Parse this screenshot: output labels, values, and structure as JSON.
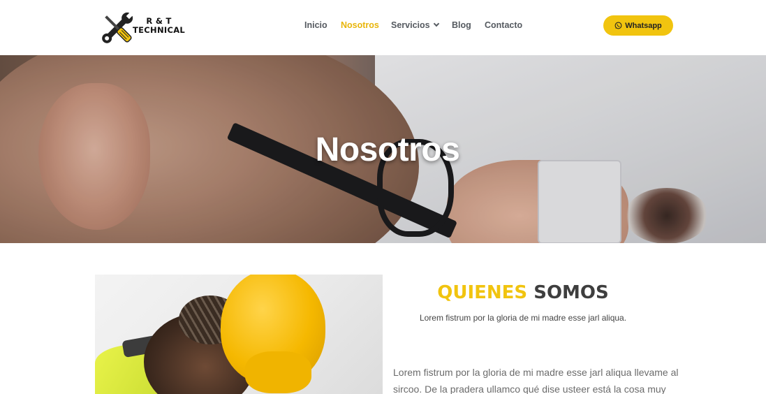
{
  "header": {
    "logo": {
      "line1": "R & T",
      "line2": "TECHNICAL",
      "icon": "tools-wrench-screwdriver-icon"
    },
    "nav": [
      {
        "label": "Inicio",
        "active": false
      },
      {
        "label": "Nosotros",
        "active": true
      },
      {
        "label": "Servicios",
        "active": false,
        "has_dropdown": true
      },
      {
        "label": "Blog",
        "active": false
      },
      {
        "label": "Contacto",
        "active": false
      }
    ],
    "whatsapp_button": {
      "label": "Whatsapp",
      "icon": "whatsapp-icon"
    }
  },
  "hero": {
    "title": "Nosotros"
  },
  "about": {
    "heading_highlight": "QUIENES",
    "heading_rest": "SOMOS",
    "subtitle": "Lorem fistrum por la gloria de mi madre esse jarl aliqua.",
    "body_line1": "Lorem fistrum por la gloria de mi madre esse jarl aliqua llevame al",
    "body_line2": "sircoo. De la pradera ullamco qué dise usteer está la cosa muy"
  },
  "colors": {
    "accent": "#f1c40f",
    "nav_text": "#555a60",
    "heading_dark": "#3e3e3e"
  }
}
